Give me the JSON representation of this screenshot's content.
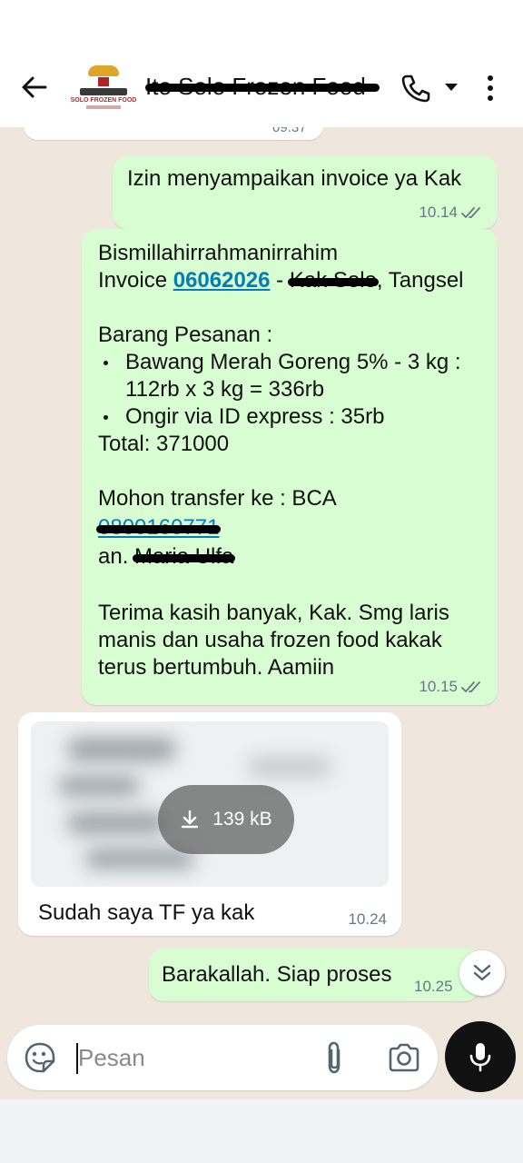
{
  "header": {
    "contact_name": "Ito Solo Frozen Food",
    "avatar_text": "SOLO FROZEN FOOD"
  },
  "chat": {
    "previous_time": "09.37",
    "messages": [
      {
        "text": "Izin menyampaikan invoice ya Kak",
        "time": "10.14"
      },
      {
        "line1": "Bismillahirrahmanirrahim",
        "invoice_prefix": "Invoice ",
        "invoice_number": "06062026",
        "invoice_sep": " - ",
        "customer": "Kak Solo",
        "location": ", Tangsel",
        "order_heading": "Barang Pesanan :",
        "item1_a": "Bawang Merah Goreng 5% - 3 kg :",
        "item1_b": "112rb x 3 kg = 336rb",
        "item2": "Ongir via ID express : 35rb",
        "total": "Total: 371000",
        "transfer": "Mohon transfer ke : BCA",
        "account_number": "0800160771",
        "account_prefix": "an. ",
        "account_name": "Maria Ulfa",
        "closing1": "Terima kasih banyak, Kak. Smg laris",
        "closing2": "manis dan usaha frozen food kakak",
        "closing3": "terus bertumbuh. Aamiin",
        "time": "10.15"
      },
      {
        "file_size": "139 kB",
        "caption": "Sudah saya TF ya kak",
        "time": "10.24"
      },
      {
        "text": "Barakallah. Siap proses",
        "time": "10.25"
      }
    ]
  },
  "input": {
    "placeholder": "Pesan"
  },
  "colors": {
    "outgoing_bubble": "#d9fdd3",
    "incoming_bubble": "#ffffff",
    "link": "#027eb5",
    "tick": "#667781"
  },
  "icons": [
    "back-arrow-icon",
    "phone-icon",
    "chevron-down-icon",
    "more-vert-icon",
    "double-check-icon",
    "download-icon",
    "double-chevron-down-icon",
    "sticker-icon",
    "paperclip-icon",
    "camera-icon",
    "mic-icon"
  ]
}
